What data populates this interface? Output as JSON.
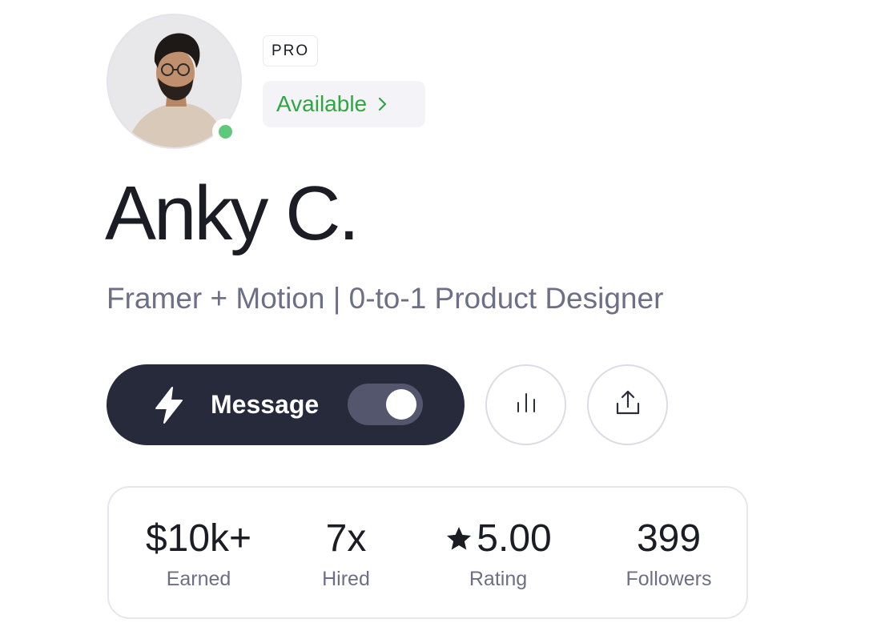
{
  "profile": {
    "badge": "PRO",
    "availability": "Available",
    "name": "Anky C.",
    "headline": "Framer + Motion | 0-to-1 Product Designer",
    "online": true
  },
  "actions": {
    "message_label": "Message",
    "message_toggle_on": true
  },
  "stats": [
    {
      "value": "$10k+",
      "label": "Earned"
    },
    {
      "value": "7x",
      "label": "Hired"
    },
    {
      "value": "5.00",
      "label": "Rating"
    },
    {
      "value": "399",
      "label": "Followers"
    }
  ],
  "colors": {
    "available_text": "#2fa642",
    "online_dot": "#5ec97a",
    "button_dark": "#262a3b",
    "muted_text": "#6c6f85"
  },
  "icons": {
    "availability_chevron": "chevron-right-icon",
    "message": "lightning-bolt-icon",
    "stats": "bar-chart-icon",
    "share": "share-upload-icon",
    "rating": "star-icon"
  }
}
